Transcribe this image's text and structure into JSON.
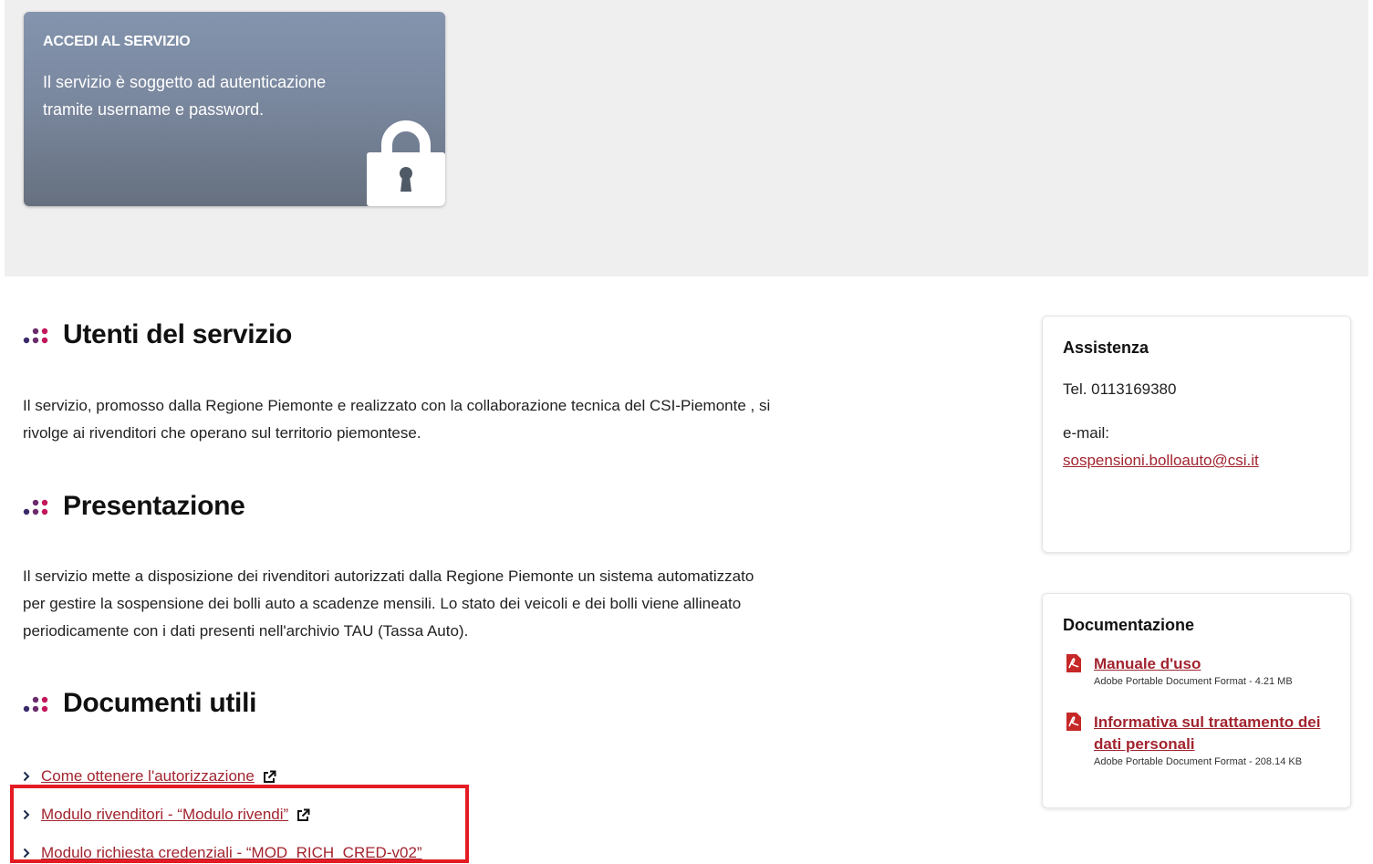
{
  "access_card": {
    "title": "ACCEDI AL SERVIZIO",
    "description": "Il servizio è soggetto ad autenticazione tramite username e password.",
    "icon": "lock-icon"
  },
  "sections": {
    "users": {
      "title": "Utenti del servizio",
      "text": "Il servizio, promosso dalla Regione Piemonte e realizzato con la collaborazione tecnica del CSI-Piemonte , si rivolge ai rivenditori che operano sul territorio piemontese."
    },
    "presentation": {
      "title": "Presentazione",
      "text": "Il servizio mette a disposizione dei rivenditori autorizzati dalla Regione Piemonte un sistema automatizzato per gestire la sospensione dei bolli auto a scadenze mensili. Lo stato dei veicoli e dei bolli viene allineato periodicamente con i dati presenti nell'archivio TAU (Tassa Auto)."
    },
    "documents": {
      "title": "Documenti utili",
      "links": [
        {
          "label": "Come ottenere l'autorizzazione",
          "external": true
        },
        {
          "label": "Modulo rivenditori - “Modulo rivendi”",
          "external": true
        },
        {
          "label": "Modulo richiesta credenziali - “MOD_RICH_CRED-v02”",
          "external": false
        }
      ]
    }
  },
  "assistance": {
    "title": "Assistenza",
    "phone": "Tel. 0113169380",
    "email_label": "e-mail:",
    "email": "sospensioni.bolloauto@csi.it"
  },
  "documentation": {
    "title": "Documentazione",
    "items": [
      {
        "title": "Manuale d'uso",
        "meta": "Adobe Portable Document Format - 4.21 MB"
      },
      {
        "title": "Informativa sul trattamento dei dati personali",
        "meta": "Adobe Portable Document Format - 208.14 KB"
      }
    ]
  },
  "colors": {
    "link": "#a2242f",
    "highlight": "#e41b23",
    "hero_bg": "#efefef",
    "card_gradient_top": "#8494ae",
    "dots": [
      "#3b2a6b",
      "#6b2b6d",
      "#c2185b"
    ]
  }
}
